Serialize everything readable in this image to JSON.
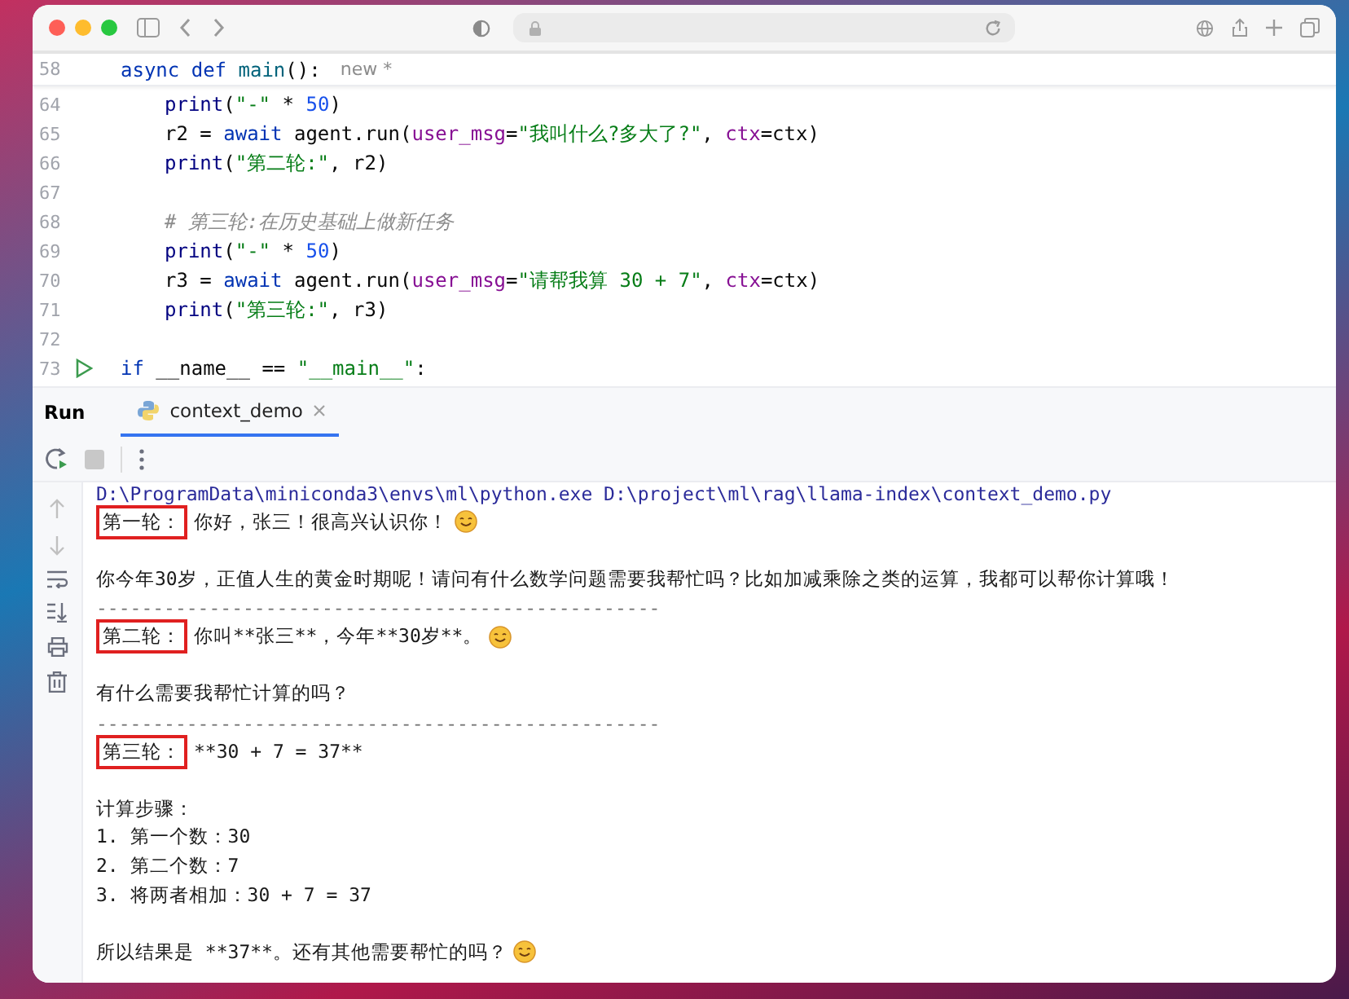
{
  "sticky_line": {
    "number": "58",
    "tokens": [
      {
        "kind": "kw",
        "text": "async def "
      },
      {
        "kind": "fn",
        "text": "main"
      },
      {
        "kind": "plain",
        "text": "():"
      }
    ],
    "hint": "new *"
  },
  "code_lines": [
    {
      "number": "64",
      "run": false,
      "indented": true,
      "tokens": [
        {
          "kind": "builtin",
          "text": "print"
        },
        {
          "kind": "plain",
          "text": "("
        },
        {
          "kind": "str",
          "text": "\"-\""
        },
        {
          "kind": "plain",
          "text": " * "
        },
        {
          "kind": "num",
          "text": "50"
        },
        {
          "kind": "plain",
          "text": ")"
        }
      ]
    },
    {
      "number": "65",
      "run": false,
      "indented": true,
      "tokens": [
        {
          "kind": "plain",
          "text": "r2 = "
        },
        {
          "kind": "kw",
          "text": "await"
        },
        {
          "kind": "plain",
          "text": " agent.run("
        },
        {
          "kind": "param",
          "text": "user_msg"
        },
        {
          "kind": "plain",
          "text": "="
        },
        {
          "kind": "str",
          "text": "\"我叫什么?多大了?\""
        },
        {
          "kind": "plain",
          "text": ", "
        },
        {
          "kind": "param",
          "text": "ctx"
        },
        {
          "kind": "plain",
          "text": "=ctx)"
        }
      ]
    },
    {
      "number": "66",
      "run": false,
      "indented": true,
      "tokens": [
        {
          "kind": "builtin",
          "text": "print"
        },
        {
          "kind": "plain",
          "text": "("
        },
        {
          "kind": "str",
          "text": "\"第二轮:\""
        },
        {
          "kind": "plain",
          "text": ", r2)"
        }
      ]
    },
    {
      "number": "67",
      "run": false
    },
    {
      "number": "68",
      "run": false,
      "indented": true,
      "tokens": [
        {
          "kind": "comment",
          "text": "# 第三轮:在历史基础上做新任务"
        }
      ]
    },
    {
      "number": "69",
      "run": false,
      "indented": true,
      "tokens": [
        {
          "kind": "builtin",
          "text": "print"
        },
        {
          "kind": "plain",
          "text": "("
        },
        {
          "kind": "str",
          "text": "\"-\""
        },
        {
          "kind": "plain",
          "text": " * "
        },
        {
          "kind": "num",
          "text": "50"
        },
        {
          "kind": "plain",
          "text": ")"
        }
      ]
    },
    {
      "number": "70",
      "run": false,
      "indented": true,
      "tokens": [
        {
          "kind": "plain",
          "text": "r3 = "
        },
        {
          "kind": "kw",
          "text": "await"
        },
        {
          "kind": "plain",
          "text": " agent.run("
        },
        {
          "kind": "param",
          "text": "user_msg"
        },
        {
          "kind": "plain",
          "text": "="
        },
        {
          "kind": "str",
          "text": "\"请帮我算 30 + 7\""
        },
        {
          "kind": "plain",
          "text": ", "
        },
        {
          "kind": "param",
          "text": "ctx"
        },
        {
          "kind": "plain",
          "text": "=ctx)"
        }
      ]
    },
    {
      "number": "71",
      "run": false,
      "indented": true,
      "tokens": [
        {
          "kind": "builtin",
          "text": "print"
        },
        {
          "kind": "plain",
          "text": "("
        },
        {
          "kind": "str",
          "text": "\"第三轮:\""
        },
        {
          "kind": "plain",
          "text": ", r3)"
        }
      ]
    },
    {
      "number": "72",
      "run": false
    },
    {
      "number": "73",
      "run": true,
      "indented": false,
      "tokens": [
        {
          "kind": "kw",
          "text": "if"
        },
        {
          "kind": "plain",
          "text": " __name__ == "
        },
        {
          "kind": "str",
          "text": "\"__main__\""
        },
        {
          "kind": "plain",
          "text": ":"
        }
      ]
    }
  ],
  "run_panel": {
    "title": "Run",
    "tabs": [
      {
        "label": "context_demo",
        "selected": true
      }
    ]
  },
  "console_lines": [
    {
      "kind": "path",
      "text": "D:\\ProgramData\\miniconda3\\envs\\ml\\python.exe D:\\project\\ml\\rag\\llama-index\\context_demo.py"
    },
    {
      "kind": "round",
      "label": "第一轮：",
      "boxed": true,
      "text": "你好，张三！很高兴认识你！",
      "emoji": true
    },
    {
      "kind": "blank"
    },
    {
      "kind": "text",
      "text": "你今年30岁，正值人生的黄金时期呢！请问有什么数学问题需要我帮忙吗？比如加减乘除之类的运算，我都可以帮你计算哦！",
      "emoji": false
    },
    {
      "kind": "separator",
      "text": "--------------------------------------------------"
    },
    {
      "kind": "round",
      "label": "第二轮：",
      "boxed": true,
      "text": "你叫**张三**，今年**30岁**。",
      "emoji": true
    },
    {
      "kind": "blank"
    },
    {
      "kind": "text",
      "text": "有什么需要我帮忙计算的吗？",
      "emoji": false
    },
    {
      "kind": "separator",
      "text": "--------------------------------------------------"
    },
    {
      "kind": "round",
      "label": "第三轮：",
      "boxed": true,
      "text": "**30 + 7 = 37**",
      "emoji": false
    },
    {
      "kind": "blank"
    },
    {
      "kind": "text",
      "text": "计算步骤：",
      "emoji": false
    },
    {
      "kind": "text",
      "text": "1. 第一个数：30",
      "emoji": false
    },
    {
      "kind": "text",
      "text": "2. 第二个数：7",
      "emoji": false
    },
    {
      "kind": "text",
      "text": "3. 将两者相加：30 + 7 = 37",
      "emoji": false
    },
    {
      "kind": "blank"
    },
    {
      "kind": "text",
      "text": "所以结果是 **37**。还有其他需要帮忙的吗？",
      "emoji": true
    }
  ]
}
